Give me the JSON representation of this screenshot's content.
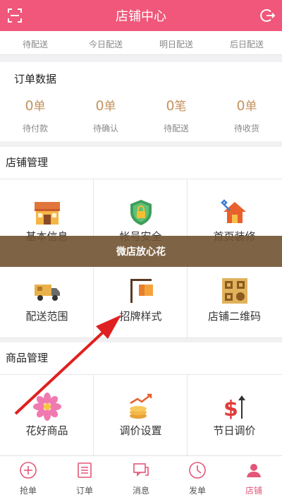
{
  "header": {
    "title": "店铺中心",
    "left_icon": "scan-icon",
    "right_icon": "logout-icon"
  },
  "delivery_tabs": [
    "待配送",
    "今日配送",
    "明日配送",
    "后日配送"
  ],
  "orders": {
    "title": "订单数据",
    "items": [
      {
        "count": "0",
        "unit": "单",
        "label": "待付款"
      },
      {
        "count": "0",
        "unit": "单",
        "label": "待确认"
      },
      {
        "count": "0",
        "unit": "笔",
        "label": "待配送"
      },
      {
        "count": "0",
        "unit": "单",
        "label": "待收货"
      }
    ]
  },
  "shop_management": {
    "title": "店铺管理",
    "items": [
      {
        "label": "基本信息",
        "icon": "storefront-icon"
      },
      {
        "label": "帐号安全",
        "icon": "shield-lock-icon"
      },
      {
        "label": "首页装修",
        "icon": "house-tools-icon"
      },
      {
        "label": "配送范围",
        "icon": "delivery-truck-icon"
      },
      {
        "label": "招牌样式",
        "icon": "signboard-icon"
      },
      {
        "label": "店铺二维码",
        "icon": "qr-code-icon"
      }
    ]
  },
  "banner": {
    "text": "微店放心花"
  },
  "goods_management": {
    "title": "商品管理",
    "items": [
      {
        "label": "花好商品",
        "icon": "flower-icon"
      },
      {
        "label": "调价设置",
        "icon": "coins-price-icon"
      },
      {
        "label": "节日调价",
        "icon": "dollar-up-icon"
      }
    ]
  },
  "bottom_nav": [
    {
      "label": "抢单",
      "icon": "plus-circle-icon"
    },
    {
      "label": "订单",
      "icon": "list-icon"
    },
    {
      "label": "消息",
      "icon": "message-icon"
    },
    {
      "label": "发单",
      "icon": "send-clock-icon"
    },
    {
      "label": "店铺",
      "icon": "user-icon",
      "active": true
    }
  ],
  "colors": {
    "brand": "#f0577a",
    "accent_gold": "#c49360",
    "annotation_arrow": "#e02020"
  }
}
